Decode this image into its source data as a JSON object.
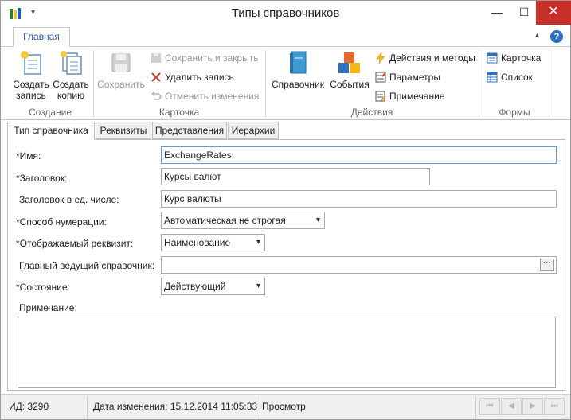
{
  "window": {
    "title": "Типы справочников",
    "min_glyph": "—",
    "max_glyph": "☐",
    "close_glyph": "✕",
    "qa_caret": "▾"
  },
  "ribbon": {
    "tab_main": "Главная",
    "collapse_caret": "▴",
    "help": "?",
    "groups": {
      "create": {
        "label": "Создание",
        "create_record_1": "Создать",
        "create_record_2": "запись",
        "create_copy_1": "Создать",
        "create_copy_2": "копию"
      },
      "card": {
        "label": "Карточка",
        "save": "Сохранить",
        "save_close": "Сохранить и закрыть",
        "delete_record": "Удалить запись",
        "cancel_changes": "Отменить изменения"
      },
      "actions": {
        "label": "Действия",
        "reference": "Справочник",
        "events": "События",
        "actions_methods": "Действия и методы",
        "parameters": "Параметры",
        "note": "Примечание"
      },
      "forms": {
        "label": "Формы",
        "card": "Карточка",
        "list": "Список"
      }
    }
  },
  "tabs": [
    "Тип справочника",
    "Реквизиты",
    "Представления",
    "Иерархии"
  ],
  "form": {
    "name_label": "*Имя:",
    "name_value": "ExchangeRates",
    "title_label": "*Заголовок:",
    "title_value": "Курсы валют",
    "title_singular_label": "Заголовок в ед. числе:",
    "title_singular_value": "Курс валюты",
    "numbering_label": "*Способ нумерации:",
    "numbering_value": "Автоматическая не строгая",
    "display_attr_label": "*Отображаемый реквизит:",
    "display_attr_value": "Наименование",
    "master_ref_label": "Главный ведущий справочник:",
    "master_ref_value": "",
    "master_ref_button": "···",
    "state_label": "*Состояние:",
    "state_value": "Действующий",
    "note_label": "Примечание:",
    "note_value": "",
    "dropdown_glyph": "▾"
  },
  "status": {
    "id": "ИД: 3290",
    "modified": "Дата изменения: 15.12.2014 11:05:33",
    "mode": "Просмотр",
    "nav": [
      "⏮",
      "◀",
      "▶",
      "⏭"
    ]
  },
  "colors": {
    "close_button": "#c7302a",
    "accent_blue": "#2a5aa4",
    "focus_border": "#569de5"
  }
}
